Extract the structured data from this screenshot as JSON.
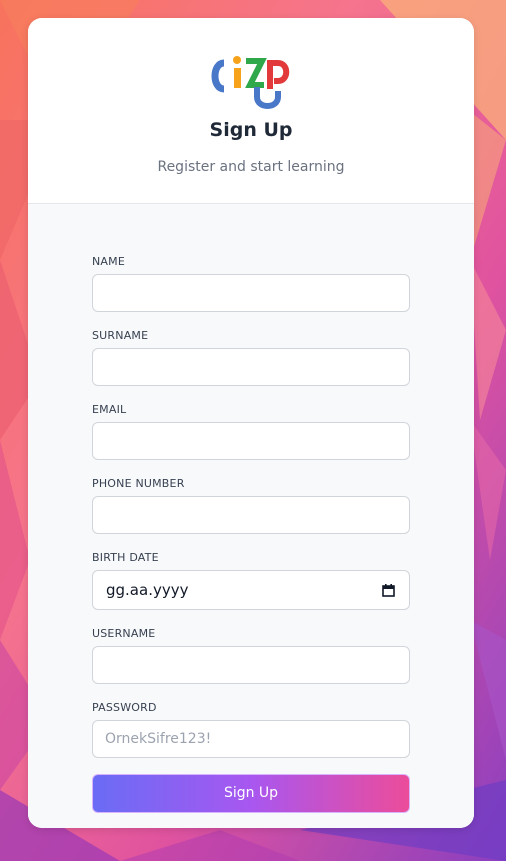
{
  "brand": {
    "logo_name": "cizup-logo"
  },
  "header": {
    "title": "Sign Up",
    "subtitle": "Register and start learning"
  },
  "form": {
    "name": {
      "label": "NAME",
      "value": "",
      "placeholder": ""
    },
    "surname": {
      "label": "SURNAME",
      "value": "",
      "placeholder": ""
    },
    "email": {
      "label": "EMAIL",
      "value": "",
      "placeholder": ""
    },
    "phone": {
      "label": "PHONE NUMBER",
      "value": "",
      "placeholder": ""
    },
    "birth_date": {
      "label": "BIRTH DATE",
      "placeholder": "gg.aa.yyyy",
      "icon": "calendar-icon"
    },
    "username": {
      "label": "USERNAME",
      "value": "",
      "placeholder": ""
    },
    "password": {
      "label": "PASSWORD",
      "value": "",
      "placeholder": "OrnekSifre123!"
    },
    "submit_label": "Sign Up"
  },
  "colors": {
    "button_gradient_start": "#6a6cf5",
    "button_gradient_mid": "#a857f0",
    "button_gradient_end": "#ec4c9a",
    "logo_blue": "#4a78c9",
    "logo_orange": "#f6a31b",
    "logo_green": "#2ea84a",
    "logo_red": "#e23a3a"
  }
}
